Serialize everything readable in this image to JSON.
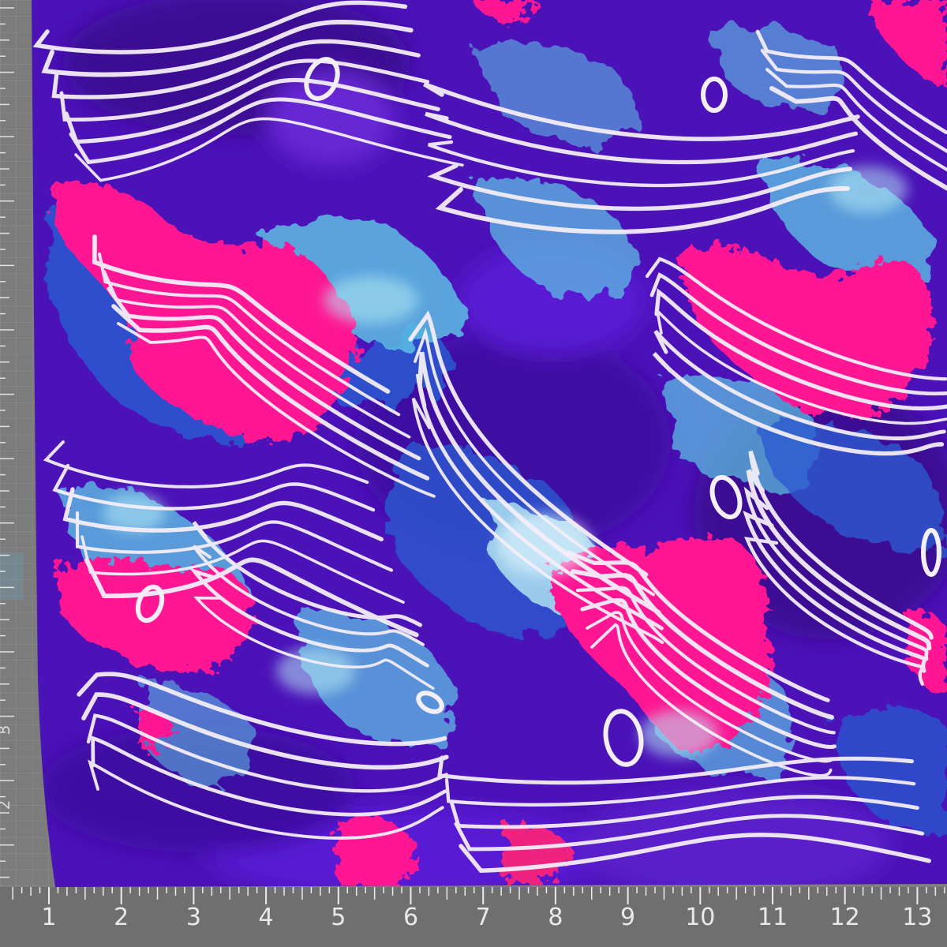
{
  "scene": {
    "subject": "fabric-swatch",
    "colors": {
      "mat": "#7c7c7c",
      "mat_grid": "#8e8e8e",
      "ruler_ink": "#ebebeb",
      "base_purple": "#4b12b8",
      "deep_purple": "#3a0c8f",
      "violet": "#6a2ad8",
      "pink": "#ff1493",
      "hot_pink": "#f0207f",
      "aqua": "#5ec8e6",
      "pale_aqua": "#b6ecf4",
      "blue": "#2a5ad0",
      "white_line": "#f4eef8"
    }
  },
  "ruler_bottom": {
    "numbers": [
      "1",
      "2",
      "3",
      "4",
      "5",
      "6",
      "7",
      "8",
      "9",
      "10",
      "11",
      "12",
      "13"
    ]
  },
  "ruler_left": {
    "numbers": [
      "3",
      "2"
    ]
  }
}
